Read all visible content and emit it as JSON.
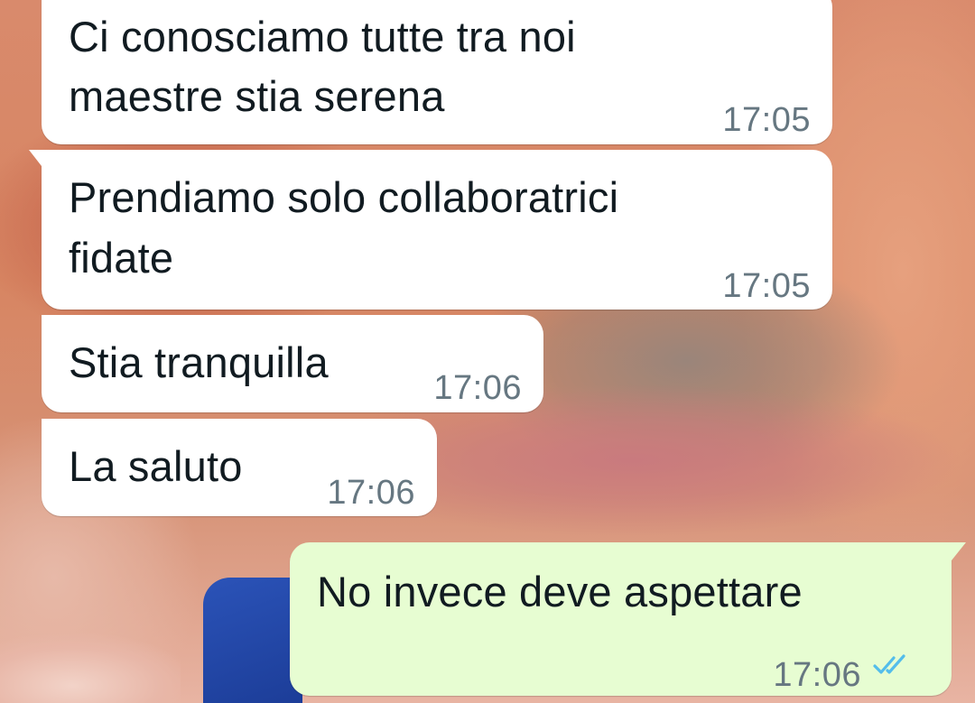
{
  "messages": [
    {
      "direction": "incoming",
      "lines": [
        "Ci conosciamo tutte tra noi",
        "maestre stia serena"
      ],
      "time": "17:05"
    },
    {
      "direction": "incoming",
      "lines": [
        "Prendiamo solo collaboratrici",
        "fidate"
      ],
      "time": "17:05"
    },
    {
      "direction": "incoming",
      "lines": [
        "Stia tranquilla"
      ],
      "time": "17:06"
    },
    {
      "direction": "incoming",
      "lines": [
        "La saluto"
      ],
      "time": "17:06"
    },
    {
      "direction": "outgoing",
      "lines": [
        "No invece deve aspettare"
      ],
      "time": "17:06",
      "status_icon": "double-check-icon",
      "status": "read"
    }
  ],
  "colors": {
    "incoming_bubble": "#ffffff",
    "outgoing_bubble": "#e7fdd2",
    "text": "#111b21",
    "timestamp": "#667781",
    "read_ticks": "#53bdeb"
  }
}
